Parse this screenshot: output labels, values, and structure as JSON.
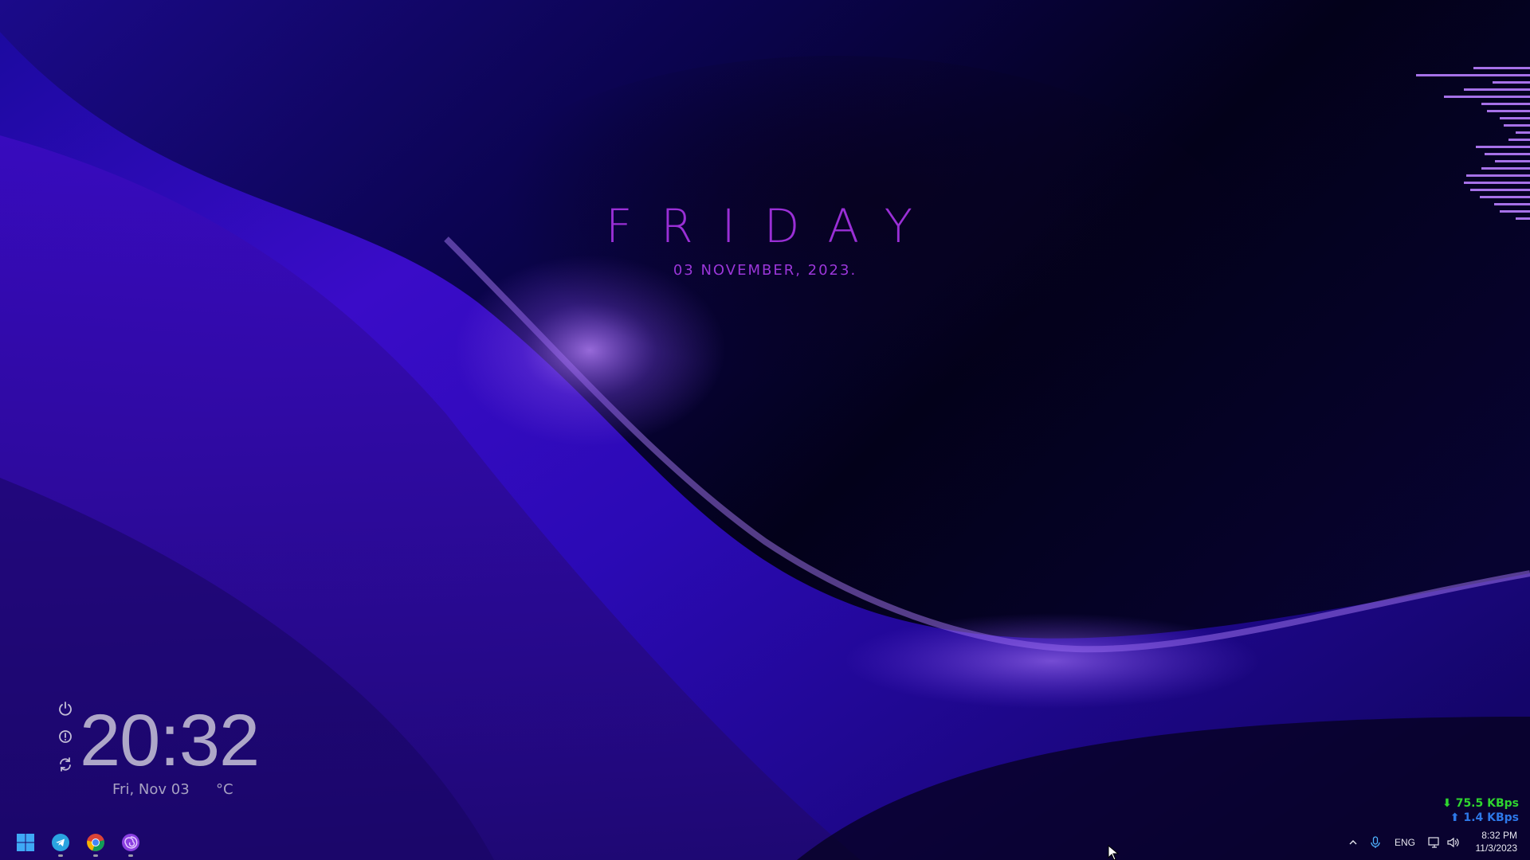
{
  "wallpaper": {
    "colors": {
      "base": "#05021a",
      "deep_blue": "#1d0a9e",
      "violet": "#4a14d8",
      "highlight": "#9b5cf0"
    }
  },
  "date_widget": {
    "day": "FRIDAY",
    "date": "03 NOVEMBER, 2023.",
    "color": "#9a2fd6"
  },
  "visualizer": {
    "color": "#a671e8",
    "bar_levels": [
      0.47,
      0.95,
      0.31,
      0.55,
      0.72,
      0.41,
      0.36,
      0.25,
      0.22,
      0.12,
      0.18,
      0.45,
      0.38,
      0.29,
      0.41,
      0.53,
      0.55,
      0.5,
      0.42,
      0.3,
      0.25,
      0.12
    ]
  },
  "clock_widget": {
    "time": "20:32",
    "date": "Fri, Nov 03",
    "temperature_unit": "°C",
    "icons": [
      "power-icon",
      "info-icon",
      "refresh-icon"
    ]
  },
  "network": {
    "download": "⬇ 75.5 KBps",
    "upload": "⬆ 1.4 KBps",
    "download_color": "#2fd62f",
    "upload_color": "#2d78e8"
  },
  "taskbar": {
    "apps": [
      {
        "name": "start-button",
        "icon": "windows-icon"
      },
      {
        "name": "telegram-button",
        "icon": "telegram-icon",
        "running": true
      },
      {
        "name": "chrome-button",
        "icon": "chrome-icon",
        "running": true
      },
      {
        "name": "app-button",
        "icon": "purple-spiral-icon",
        "running": true
      }
    ],
    "tray": {
      "language": "ENG",
      "time": "8:32 PM",
      "date": "11/3/2023"
    }
  }
}
